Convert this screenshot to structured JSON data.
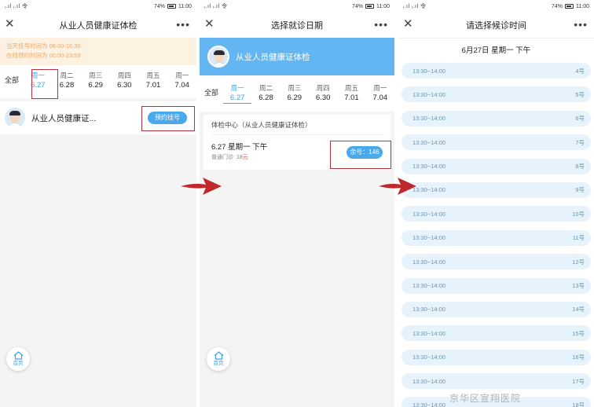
{
  "status": {
    "signal": "ᵢ.ıl ᵢ.ıl 令",
    "battery": "74%",
    "time": "11:00"
  },
  "panel1": {
    "title": "从业人员健康证体检",
    "notice": [
      "当天挂号时间为 08:00-16:30",
      "在线预约时间为 00:00-23:59"
    ],
    "all_label": "全部",
    "days": [
      {
        "name": "周一",
        "date": "6.27"
      },
      {
        "name": "周二",
        "date": "6.28"
      },
      {
        "name": "周三",
        "date": "6.29"
      },
      {
        "name": "周四",
        "date": "6.30"
      },
      {
        "name": "周五",
        "date": "7.01"
      },
      {
        "name": "周一",
        "date": "7.04"
      }
    ],
    "doctor_name": "从业人员健康证...",
    "book_button": "预约挂号",
    "home_label": "首页"
  },
  "panel2": {
    "title": "选择就诊日期",
    "header_title": "从业人员健康证体检",
    "center": "体检中心（从业人员健康证体检）",
    "slot_main": "6.27  星期一  下午",
    "slot_type": "普通门诊",
    "slot_price": "18元",
    "remain": "余号：146",
    "home_label": "首页"
  },
  "panel3": {
    "title": "请选择候诊时间",
    "date_line": "6月27日  星期一  下午",
    "slots": [
      {
        "time": "13:30~14:00",
        "num": "4号"
      },
      {
        "time": "13:30~14:00",
        "num": "5号"
      },
      {
        "time": "13:30~14:00",
        "num": "6号"
      },
      {
        "time": "13:30~14:00",
        "num": "7号"
      },
      {
        "time": "13:30~14:00",
        "num": "8号"
      },
      {
        "time": "13:30~14:00",
        "num": "9号"
      },
      {
        "time": "13:30~14:00",
        "num": "10号"
      },
      {
        "time": "13:30~14:00",
        "num": "11号"
      },
      {
        "time": "13:30~14:00",
        "num": "12号"
      },
      {
        "time": "13:30~14:00",
        "num": "13号"
      },
      {
        "time": "13:30~14:00",
        "num": "14号"
      },
      {
        "time": "13:30~14:00",
        "num": "15号"
      },
      {
        "time": "13:30~14:00",
        "num": "16号"
      },
      {
        "time": "13:30~14:00",
        "num": "17号"
      },
      {
        "time": "13:30~14:00",
        "num": "18号"
      }
    ]
  },
  "watermark": "京华区宣翔医院",
  "colors": {
    "accent": "#4aa8ec",
    "highlight": "#b5333b",
    "arrow": "#c0282d"
  }
}
